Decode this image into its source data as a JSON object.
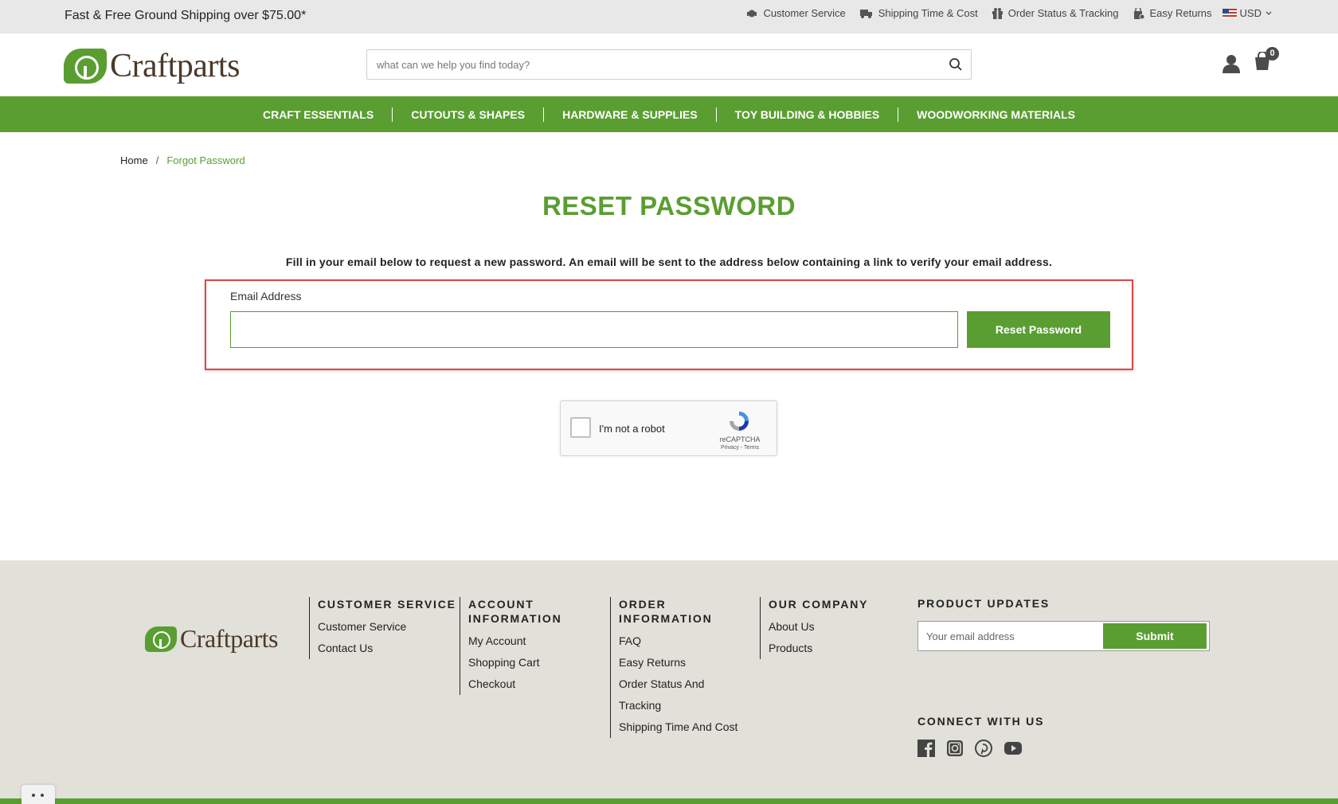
{
  "topbar": {
    "promo": "Fast & Free Ground Shipping over $75.00*",
    "links": [
      {
        "label": "Customer Service",
        "icon": "headset-icon"
      },
      {
        "label": "Shipping Time & Cost",
        "icon": "truck-icon"
      },
      {
        "label": "Order Status & Tracking",
        "icon": "gift-icon"
      },
      {
        "label": "Easy Returns",
        "icon": "return-bag-icon"
      }
    ],
    "currency": "USD"
  },
  "header": {
    "logo_text": "Craftparts",
    "search_placeholder": "what can we help you find today?",
    "cart_count": "0"
  },
  "nav": [
    "CRAFT ESSENTIALS",
    "CUTOUTS & SHAPES",
    "HARDWARE & SUPPLIES",
    "TOY BUILDING & HOBBIES",
    "WOODWORKING MATERIALS"
  ],
  "breadcrumb": {
    "home": "Home",
    "current": "Forgot Password"
  },
  "page": {
    "title": "RESET PASSWORD",
    "intro": "Fill in your email below to request a new password. An email will be sent to the address below containing a link to verify your email address.",
    "email_label": "Email Address",
    "email_value": "",
    "submit_label": "Reset Password"
  },
  "captcha": {
    "label": "I'm not a robot",
    "brand": "reCAPTCHA",
    "terms": "Privacy - Terms"
  },
  "footer": {
    "logo_text": "Craftparts",
    "columns": [
      {
        "title": "CUSTOMER SERVICE",
        "links": [
          "Customer Service",
          "Contact Us"
        ]
      },
      {
        "title": "ACCOUNT INFORMATION",
        "links": [
          "My Account",
          "Shopping Cart",
          "Checkout"
        ]
      },
      {
        "title": "ORDER INFORMATION",
        "links": [
          "FAQ",
          "Easy Returns",
          "Order Status And Tracking",
          "Shipping Time And Cost"
        ]
      },
      {
        "title": "OUR COMPANY",
        "links": [
          "About Us",
          "Products"
        ]
      }
    ],
    "updates_title": "PRODUCT UPDATES",
    "newsletter_placeholder": "Your email address",
    "newsletter_button": "Submit",
    "connect_title": "CONNECT WITH US",
    "social": [
      "facebook-icon",
      "instagram-icon",
      "pinterest-icon",
      "youtube-icon"
    ]
  },
  "colors": {
    "brand_green": "#5a9e32",
    "highlight_red": "#e04545",
    "footer_bg": "#e1e0d9"
  }
}
